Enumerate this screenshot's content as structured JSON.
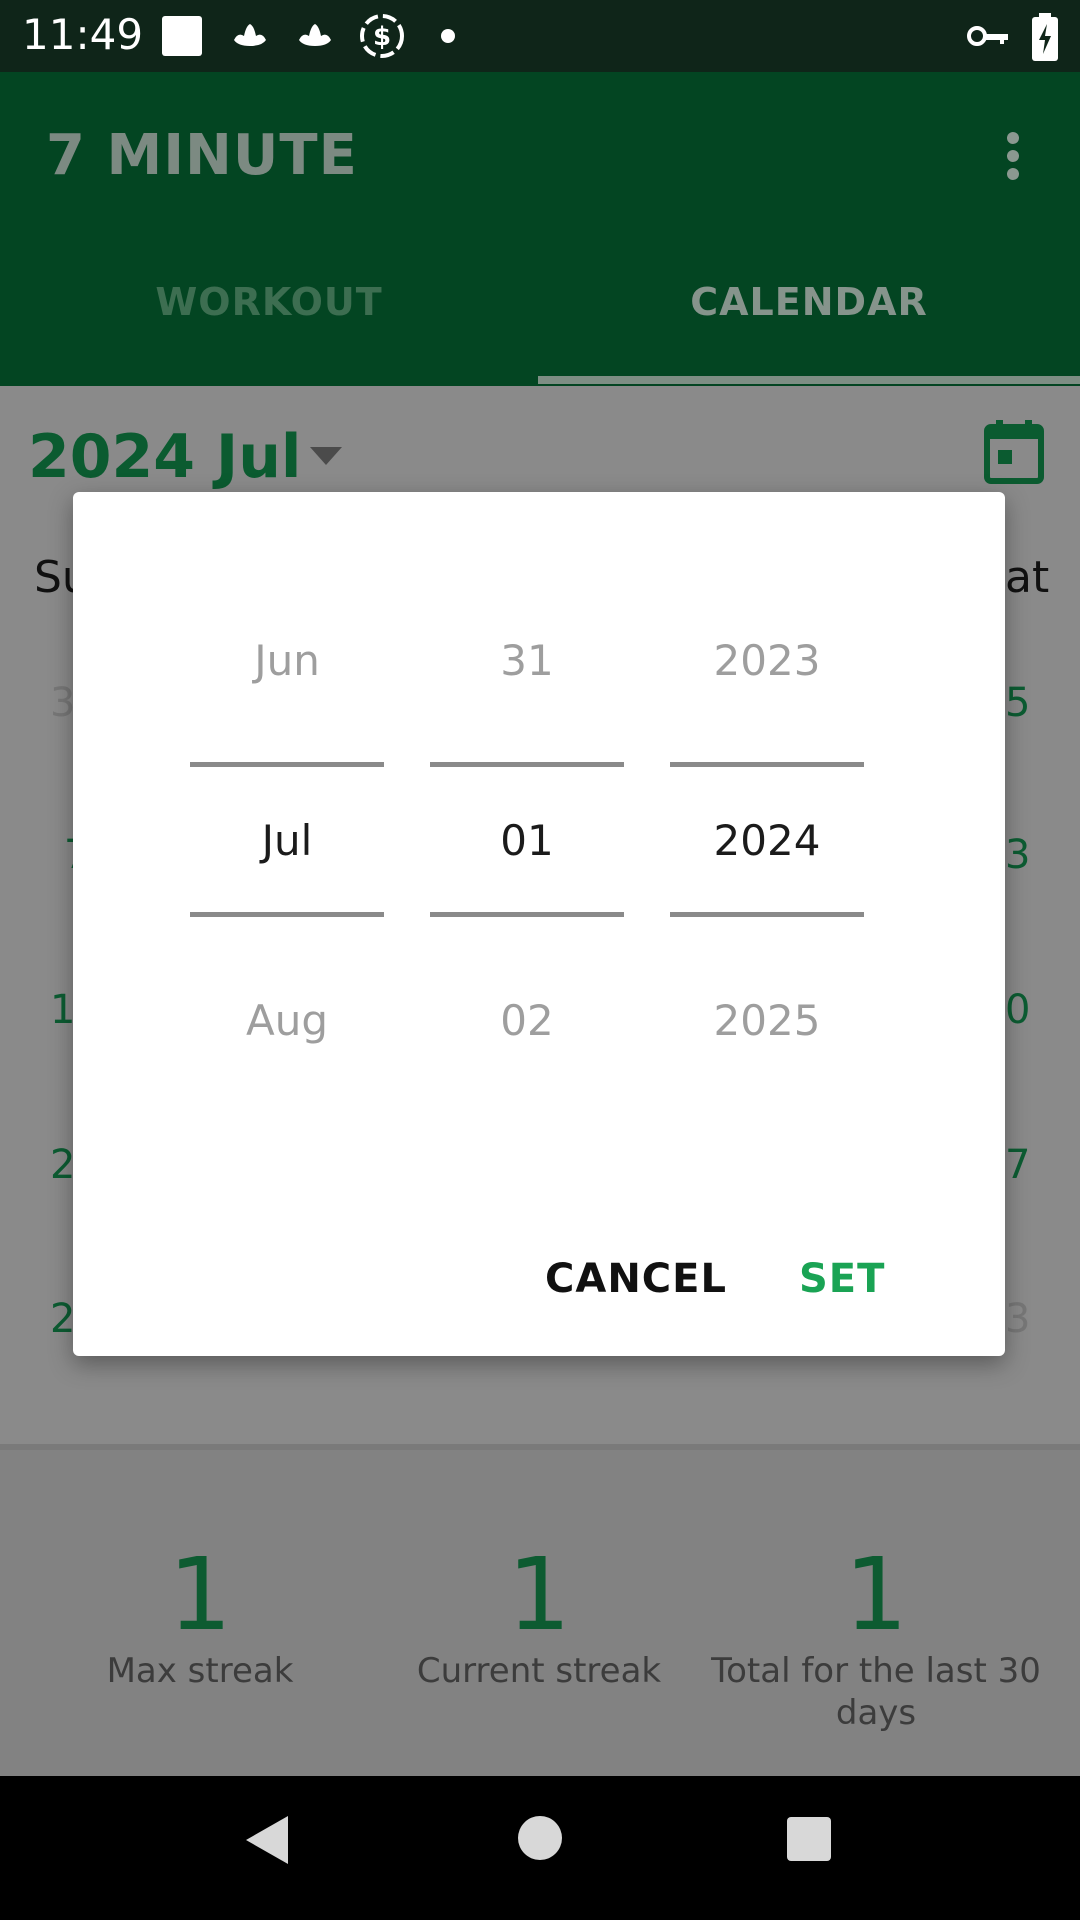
{
  "status_bar": {
    "time": "11:49",
    "icons_left": [
      "square-notification-icon",
      "lotus-icon",
      "lotus-icon",
      "dollar-sync-icon",
      "dot-icon"
    ],
    "icons_right": [
      "vpn-key-icon",
      "battery-charging-icon"
    ]
  },
  "app_bar": {
    "title": "7 MINUTE",
    "overflow_icon": "more-vert-icon",
    "tabs": [
      {
        "label": "WORKOUT",
        "selected": false
      },
      {
        "label": "CALENDAR",
        "selected": true
      }
    ]
  },
  "calendar": {
    "month_title": "2024 Jul",
    "weekday_first": "Su",
    "weekday_last": "at",
    "left_edge_days": [
      "3",
      "7",
      "1",
      "2",
      "2"
    ],
    "right_edge_days": [
      "5",
      "3",
      "0",
      "7",
      "3"
    ]
  },
  "stats": [
    {
      "value": "1",
      "label": "Max streak"
    },
    {
      "value": "1",
      "label": "Current streak"
    },
    {
      "value": "1",
      "label": "Total for the last 30 days"
    }
  ],
  "date_picker": {
    "month": {
      "prev": "Jun",
      "selected": "Jul",
      "next": "Aug"
    },
    "day": {
      "prev": "31",
      "selected": "01",
      "next": "02"
    },
    "year": {
      "prev": "2023",
      "selected": "2024",
      "next": "2025"
    },
    "cancel_label": "CANCEL",
    "set_label": "SET"
  },
  "colors": {
    "app_bar": "#034522",
    "accent": "#1aa354",
    "scrim_content": "#8a8a8a"
  }
}
